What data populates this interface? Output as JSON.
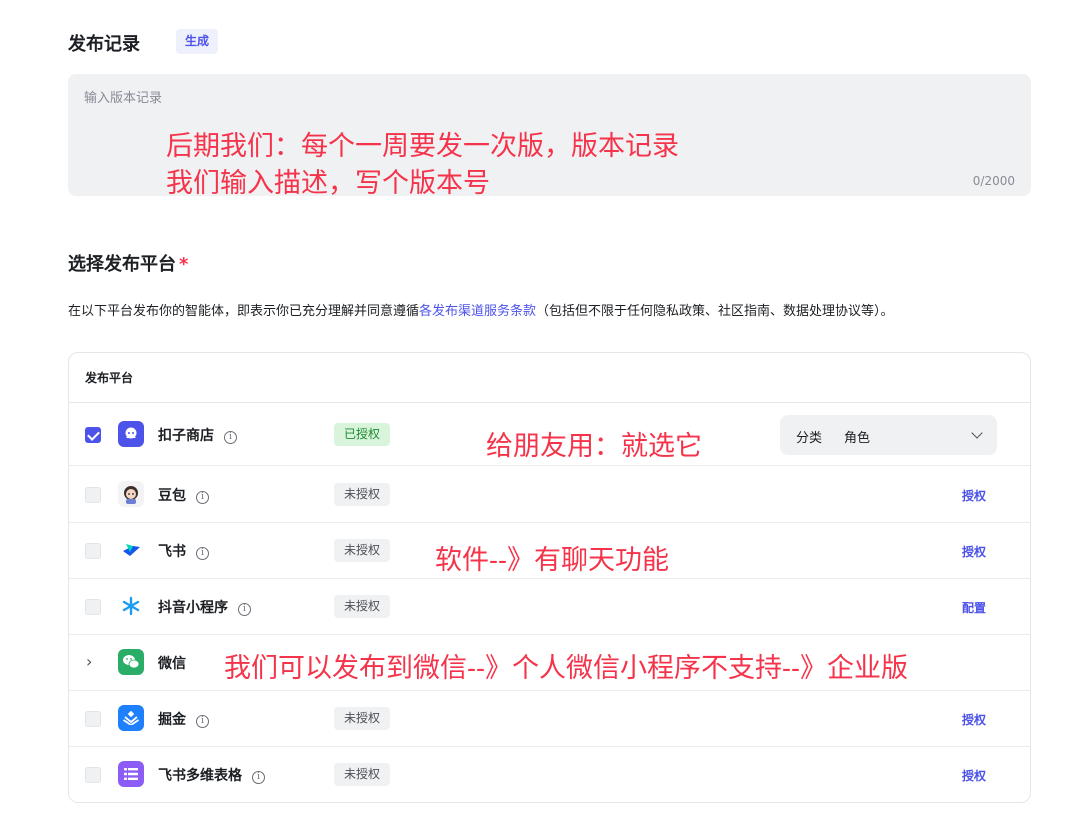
{
  "release": {
    "title": "发布记录",
    "generate_label": "生成",
    "textarea_placeholder": "输入版本记录",
    "counter": "0/2000"
  },
  "annotations": [
    "后期我们：每个一周要发一次版，版本记录",
    "我们输入描述，写个版本号",
    "给朋友用：就选它",
    "软件--》有聊天功能",
    "我们可以发布到微信--》个人微信小程序不支持--》企业版"
  ],
  "platform": {
    "title": "选择发布平台",
    "required_mark": "*",
    "agreement_before": "在以下平台发布你的智能体，即表示你已充分理解并同意遵循",
    "agreement_link": "各发布渠道服务条款",
    "agreement_after": "（包括但不限于任何隐私政策、社区指南、数据处理协议等）。",
    "table_header": "发布平台",
    "rows": [
      {
        "name": "扣子商店",
        "icon": "coze-store-icon",
        "icon_color": "#4d53e8",
        "badge": "已授权",
        "checked": true,
        "category_label": "分类",
        "category_value": "角色"
      },
      {
        "name": "豆包",
        "icon": "doubao-icon",
        "badge": "未授权",
        "action": "授权"
      },
      {
        "name": "飞书",
        "icon": "feishu-icon",
        "badge": "未授权",
        "action": "授权"
      },
      {
        "name": "抖音小程序",
        "icon": "douyin-miniapp-icon",
        "badge": "未授权",
        "action": "配置"
      },
      {
        "name": "微信",
        "icon": "wechat-icon",
        "icon_color": "#2aae67",
        "expandable": true
      },
      {
        "name": "掘金",
        "icon": "juejin-icon",
        "icon_color": "#1e80ff",
        "badge": "未授权",
        "action": "授权"
      },
      {
        "name": "飞书多维表格",
        "icon": "feishu-bitable-icon",
        "icon_color": "#8b5cf6",
        "badge": "未授权",
        "action": "授权"
      }
    ]
  },
  "colors": {
    "accent": "#4d53e8",
    "annotation": "#f5344b",
    "authorized_bg": "#d8f5dc",
    "authorized_text": "#1f8a35"
  }
}
